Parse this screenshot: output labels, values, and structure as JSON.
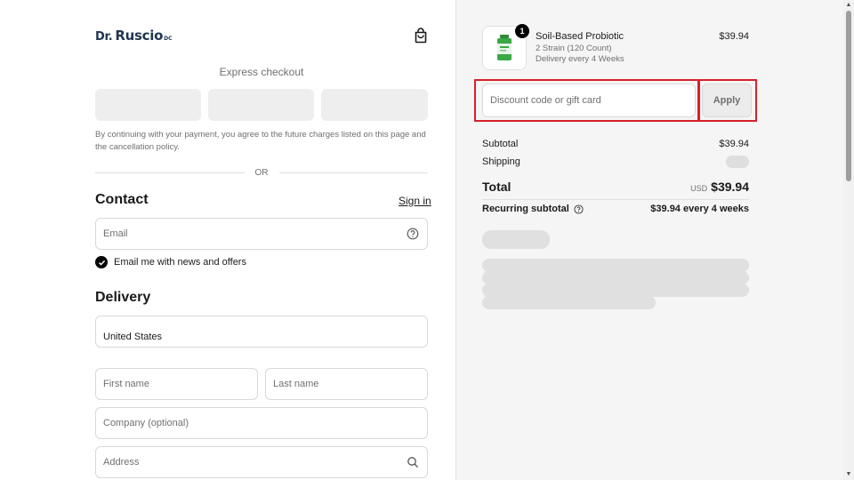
{
  "brand": {
    "logo_dr": "Dr.",
    "logo_name": "Ruscio",
    "logo_suffix": "DC"
  },
  "header": {
    "cart_icon": "shopping-bag-icon"
  },
  "express": {
    "title": "Express checkout",
    "agreement": "By continuing with your payment, you agree to the future charges listed on this page and the cancellation policy.",
    "divider": "OR"
  },
  "contact": {
    "heading": "Contact",
    "sign_in": "Sign in",
    "email_placeholder": "Email",
    "email_icon": "help-circle-icon",
    "newsletter_label": "Email me with news and offers",
    "newsletter_checked": true
  },
  "delivery": {
    "heading": "Delivery",
    "country": "United States",
    "first_name_placeholder": "First name",
    "last_name_placeholder": "Last name",
    "company_placeholder": "Company (optional)",
    "address_placeholder": "Address",
    "address_icon": "search-icon"
  },
  "order": {
    "quantity": "1",
    "product_name": "Soil-Based Probiotic",
    "variant": "2 Strain (120 Count)",
    "delivery_freq": "Delivery every 4 Weeks",
    "price": "$39.94",
    "discount_placeholder": "Discount code or gift card",
    "apply_label": "Apply"
  },
  "summary": {
    "subtotal_label": "Subtotal",
    "subtotal_value": "$39.94",
    "shipping_label": "Shipping",
    "total_label": "Total",
    "total_currency": "USD",
    "total_value": "$39.94",
    "recurring_label": "Recurring subtotal",
    "recurring_value": "$39.94 every 4 weeks"
  },
  "colors": {
    "highlight": "#d8202a",
    "brand": "#1f3550",
    "product_green": "#3aa845"
  }
}
